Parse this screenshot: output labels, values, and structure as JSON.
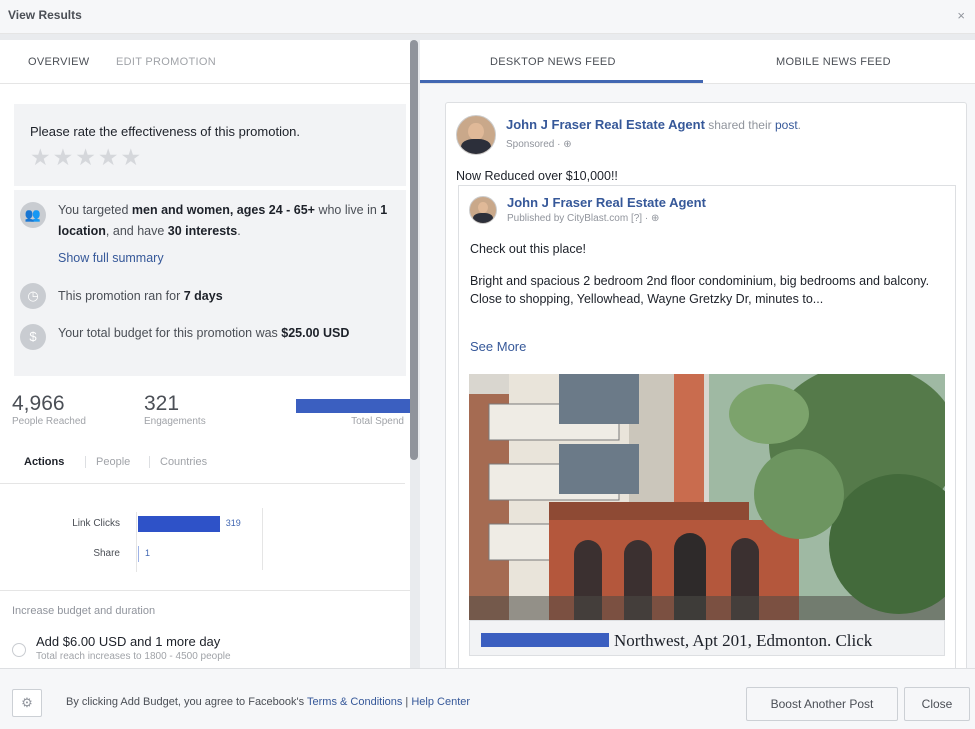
{
  "window": {
    "title": "View Results",
    "close_glyph": "×"
  },
  "left_tabs": {
    "overview": "OVERVIEW",
    "edit": "EDIT PROMOTION"
  },
  "rating": {
    "prompt": "Please rate the effectiveness of this promotion.",
    "stars": "★★★★★",
    "value": 0,
    "max": 5
  },
  "summary": {
    "targeting": {
      "t1": "You targeted ",
      "b1": "men and women, ages 24 - 65+",
      "t2": " who live in ",
      "b2": "1 location",
      "t3": ", and have ",
      "b3": "30 interests",
      "t4": "."
    },
    "show_full": "Show full summary",
    "duration": {
      "t1": "This promotion ran for ",
      "b1": "7 days"
    },
    "budget": {
      "t1": "Your total budget for this promotion was ",
      "b1": "$25.00 USD"
    }
  },
  "metrics": [
    {
      "value": "4,966",
      "label": "People Reached"
    },
    {
      "value": "321",
      "label": "Engagements"
    },
    {
      "label": "Total Spend"
    }
  ],
  "action_tabs": {
    "actions": "Actions",
    "people": "People",
    "countries": "Countries"
  },
  "actions_chart": {
    "type": "bar",
    "categories": [
      "Link Clicks",
      "Share"
    ],
    "values": [
      319,
      1
    ],
    "max": 320
  },
  "budget_offer": {
    "title": "Increase budget and duration",
    "option": "Add $6.00 USD and 1 more day",
    "sub": "Total reach increases to 1800 - 4500 people"
  },
  "right_tabs": {
    "desktop": "DESKTOP NEWS FEED",
    "mobile": "MOBILE NEWS FEED"
  },
  "post": {
    "author": "John J Fraser Real Estate Agent",
    "shared_text": " shared their ",
    "post_link": "post",
    "post_period": ".",
    "sponsored": "Sponsored · ⊕",
    "text": "Now Reduced over $10,000!!",
    "shared": {
      "author": "John J Fraser Real Estate Agent",
      "published": "Published by CityBlast.com [?] · ⊕",
      "line1": "Check out this place!",
      "line2": "Bright and spacious 2 bedroom 2nd floor condominium, big bedrooms and balcony. Close to shopping, Yellowhead, Wayne Gretzky Dr, minutes to...",
      "see_more": "See More",
      "caption": "Northwest, Apt 201, Edmonton. Click"
    }
  },
  "footer": {
    "gear": "⚙",
    "terms_prefix": "By clicking Add Budget, you agree to Facebook's ",
    "terms_link": "Terms & Conditions",
    "separator": " | ",
    "help_link": "Help Center",
    "boost": "Boost Another Post",
    "close": "Close"
  },
  "colors": {
    "link": "#365899",
    "bar": "#2e52c8",
    "accent": "#4267b2",
    "redaction": "#3b5fc0"
  },
  "icons": [
    "people-icon",
    "clock-icon",
    "money-icon",
    "gear-icon",
    "close-icon"
  ]
}
